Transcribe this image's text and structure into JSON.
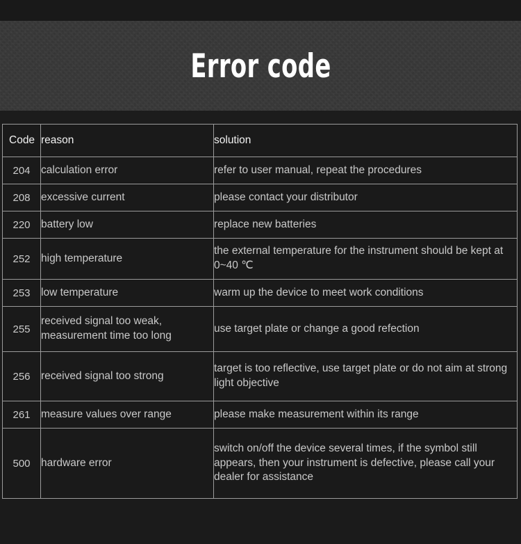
{
  "banner": {
    "title": "Error code"
  },
  "table": {
    "columns": [
      "Code",
      "reason",
      "solution"
    ],
    "rows": [
      {
        "code": "204",
        "reason": "calculation error",
        "solution": "refer to user manual, repeat the procedures"
      },
      {
        "code": "208",
        "reason": "excessive current",
        "solution": "please contact your distributor"
      },
      {
        "code": "220",
        "reason": "battery low",
        "solution": "replace new batteries"
      },
      {
        "code": "252",
        "reason": "high temperature",
        "solution": "the external temperature for the instrument should be kept at 0~40 ℃"
      },
      {
        "code": "253",
        "reason": "low temperature",
        "solution": "warm up the device to meet work conditions"
      },
      {
        "code": "255",
        "reason": "received signal too weak, measurement time too long",
        "solution": "use target plate or change a good refection"
      },
      {
        "code": "256",
        "reason": "received signal too strong",
        "solution": "target is too reflective, use target plate or do not aim at strong light objective"
      },
      {
        "code": "261",
        "reason": "measure values over range",
        "solution": "please make measurement within its range"
      },
      {
        "code": "500",
        "reason": "hardware error",
        "solution": "switch on/off the device several times, if the symbol still appears, then your instrument is defective, please call your dealer for assistance"
      }
    ]
  },
  "colors": {
    "page_background": "#1b1b1b",
    "banner_background": "#373737",
    "table_border": "#9b9b9b",
    "cell_background": "#1a1a1a",
    "header_text": "#f2f2f2",
    "body_text": "#c9c9c9",
    "title_text": "#ffffff"
  }
}
